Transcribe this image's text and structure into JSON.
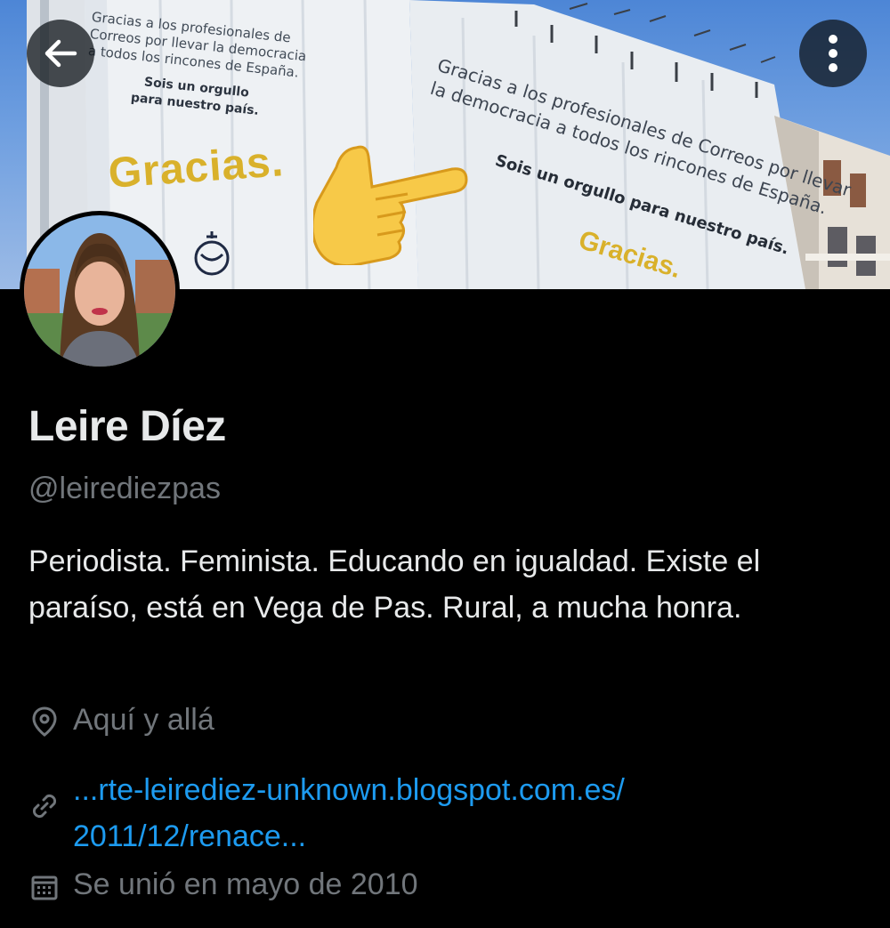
{
  "header": {
    "back_icon": "arrow-left-icon",
    "more_icon": "more-vertical-icon"
  },
  "banner": {
    "left_sign": {
      "lines": [
        "Gracias a los profesionales de",
        "Correos por llevar la democracia",
        "a todos los rincones de España."
      ],
      "bold_lines": [
        "Sois un orgullo",
        "para nuestro país."
      ],
      "gracias": "Gracias."
    },
    "right_sign": {
      "lines": [
        "Gracias a los profesionales de Correos por llevar",
        "la democracia a todos los rincones de España."
      ],
      "bold": "Sois un orgullo para nuestro país.",
      "gracias": "Gracias."
    },
    "emoji": "backhand-index-pointing-right"
  },
  "profile": {
    "name": "Leire Díez",
    "handle": "@leirediezpas",
    "bio": "Periodista. Feminista. Educando en igualdad. Existe el paraíso, está en Vega de Pas. Rural, a mucha honra.",
    "location": "Aquí y allá",
    "website_line1": "...rte-leirediez-unknown.blogspot.com.es/",
    "website_line2": "2011/12/renace...",
    "joined": "Se unió en mayo de 2010"
  },
  "colors": {
    "background": "#000000",
    "text_primary": "#e7e9ea",
    "text_secondary": "#71767b",
    "link": "#1d9bf0",
    "gracias_yellow": "#d9b12b"
  }
}
